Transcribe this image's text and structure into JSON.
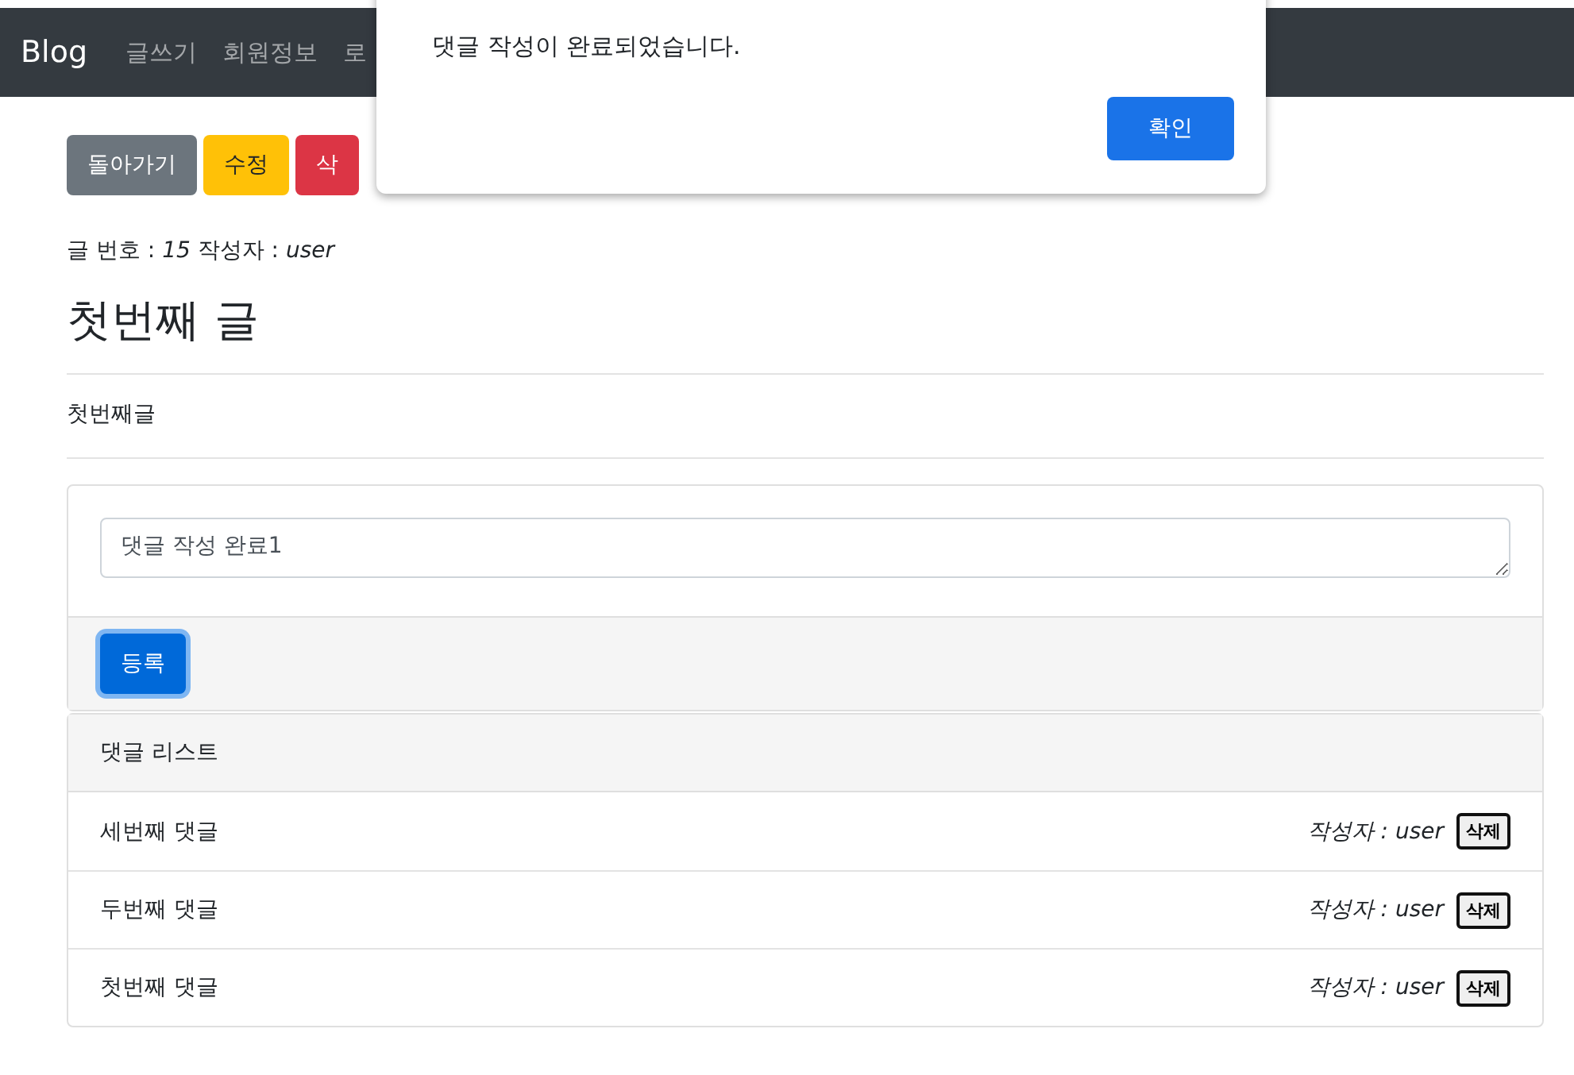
{
  "navbar": {
    "brand": "Blog",
    "links": [
      "글쓰기",
      "회원정보",
      "로"
    ]
  },
  "actions": [
    {
      "label": "돌아가기",
      "kind": "secondary"
    },
    {
      "label": "수정",
      "kind": "warning"
    },
    {
      "label": "삭",
      "kind": "danger"
    }
  ],
  "meta": "글 번호 : *15* 작성자 : *user*",
  "post": {
    "title": "첫번째 글",
    "content": "첫번째글"
  },
  "reply_form": {
    "value": "댓글 작성 완료1",
    "submit": "등록"
  },
  "replies": {
    "header": "댓글 리스트",
    "items": [
      {
        "content": "세번째 댓글",
        "author": "작성자 : user",
        "delete": "삭제"
      },
      {
        "content": "두번째 댓글",
        "author": "작성자 : user",
        "delete": "삭제"
      },
      {
        "content": "첫번째 댓글",
        "author": "작성자 : user",
        "delete": "삭제"
      }
    ]
  },
  "dialog": {
    "message": "댓글 작성이 완료되었습니다.",
    "ok": "확인"
  }
}
